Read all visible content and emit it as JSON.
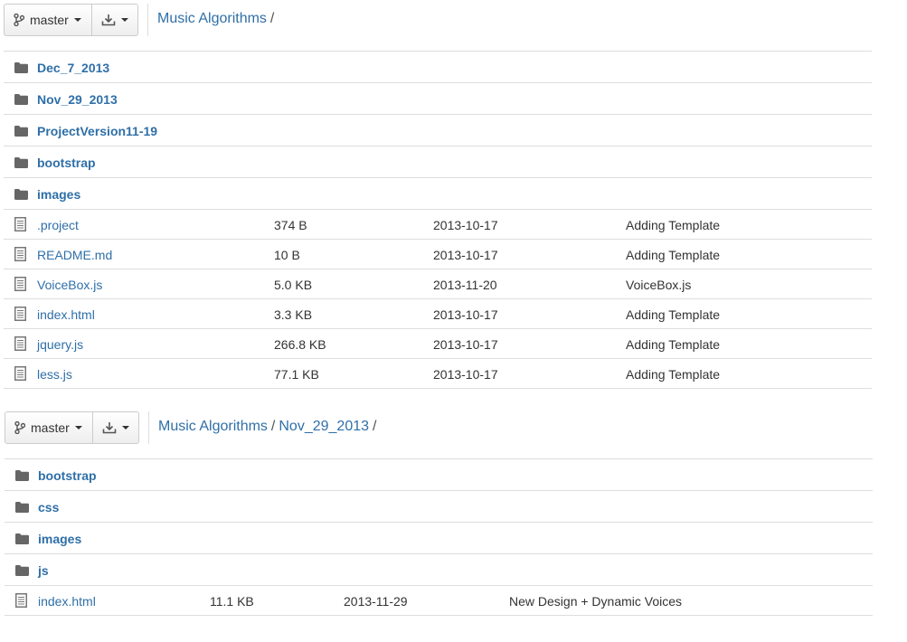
{
  "panels": [
    {
      "branch_label": "master",
      "breadcrumbs": [
        "Music Algorithms"
      ],
      "dirs": [
        "Dec_7_2013",
        "Nov_29_2013",
        "ProjectVersion11-19",
        "bootstrap",
        "images"
      ],
      "files": [
        {
          "name": ".project",
          "size": "374 B",
          "date": "2013-10-17",
          "message": "Adding Template"
        },
        {
          "name": "README.md",
          "size": "10 B",
          "date": "2013-10-17",
          "message": "Adding Template"
        },
        {
          "name": "VoiceBox.js",
          "size": "5.0 KB",
          "date": "2013-11-20",
          "message": "VoiceBox.js"
        },
        {
          "name": "index.html",
          "size": "3.3 KB",
          "date": "2013-10-17",
          "message": "Adding Template"
        },
        {
          "name": "jquery.js",
          "size": "266.8 KB",
          "date": "2013-10-17",
          "message": "Adding Template"
        },
        {
          "name": "less.js",
          "size": "77.1 KB",
          "date": "2013-10-17",
          "message": "Adding Template"
        }
      ]
    },
    {
      "branch_label": "master",
      "breadcrumbs": [
        "Music Algorithms",
        "Nov_29_2013"
      ],
      "dirs": [
        "bootstrap",
        "css",
        "images",
        "js"
      ],
      "files": [
        {
          "name": "index.html",
          "size": "11.1 KB",
          "date": "2013-11-29",
          "message": "New Design + Dynamic Voices"
        }
      ]
    }
  ],
  "icons": {
    "branch": "git-branch-icon",
    "download": "download-icon",
    "folder": "folder-icon",
    "file": "file-icon"
  },
  "colors": {
    "link": "#2f6fa8",
    "text": "#333333",
    "divider": "#dddddd",
    "icon": "#666666"
  }
}
